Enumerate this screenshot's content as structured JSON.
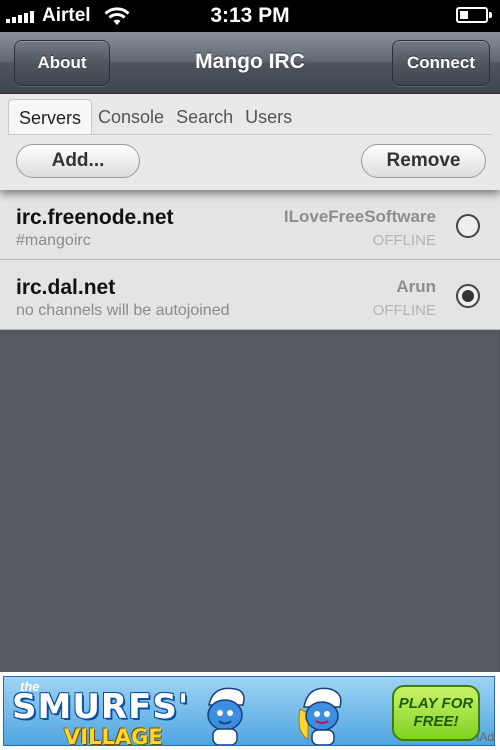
{
  "status_bar": {
    "carrier": "Airtel",
    "time": "3:13 PM",
    "battery_level": 0.28
  },
  "nav": {
    "left_button": "About",
    "title": "Mango IRC",
    "right_button": "Connect"
  },
  "tabs": [
    {
      "label": "Servers",
      "active": true
    },
    {
      "label": "Console",
      "active": false
    },
    {
      "label": "Search",
      "active": false
    },
    {
      "label": "Users",
      "active": false
    }
  ],
  "actions": {
    "add": "Add...",
    "remove": "Remove"
  },
  "servers": [
    {
      "host": "irc.freenode.net",
      "channels": "#mangoirc",
      "nick": "ILoveFreeSoftware",
      "status": "OFFLINE",
      "selected": false
    },
    {
      "host": "irc.dal.net",
      "channels": "no channels will be autojoined",
      "nick": "Arun",
      "status": "OFFLINE",
      "selected": true
    }
  ],
  "ad": {
    "small_text": "the",
    "title": "SMURFS'",
    "subtitle": "VILLAGE",
    "cta_line1": "PLAY FOR",
    "cta_line2": "FREE!",
    "provider": "iAd"
  },
  "colors": {
    "nav_bar": "#4c535d",
    "background": "#55595f",
    "list_row": "#e4e4e4"
  }
}
